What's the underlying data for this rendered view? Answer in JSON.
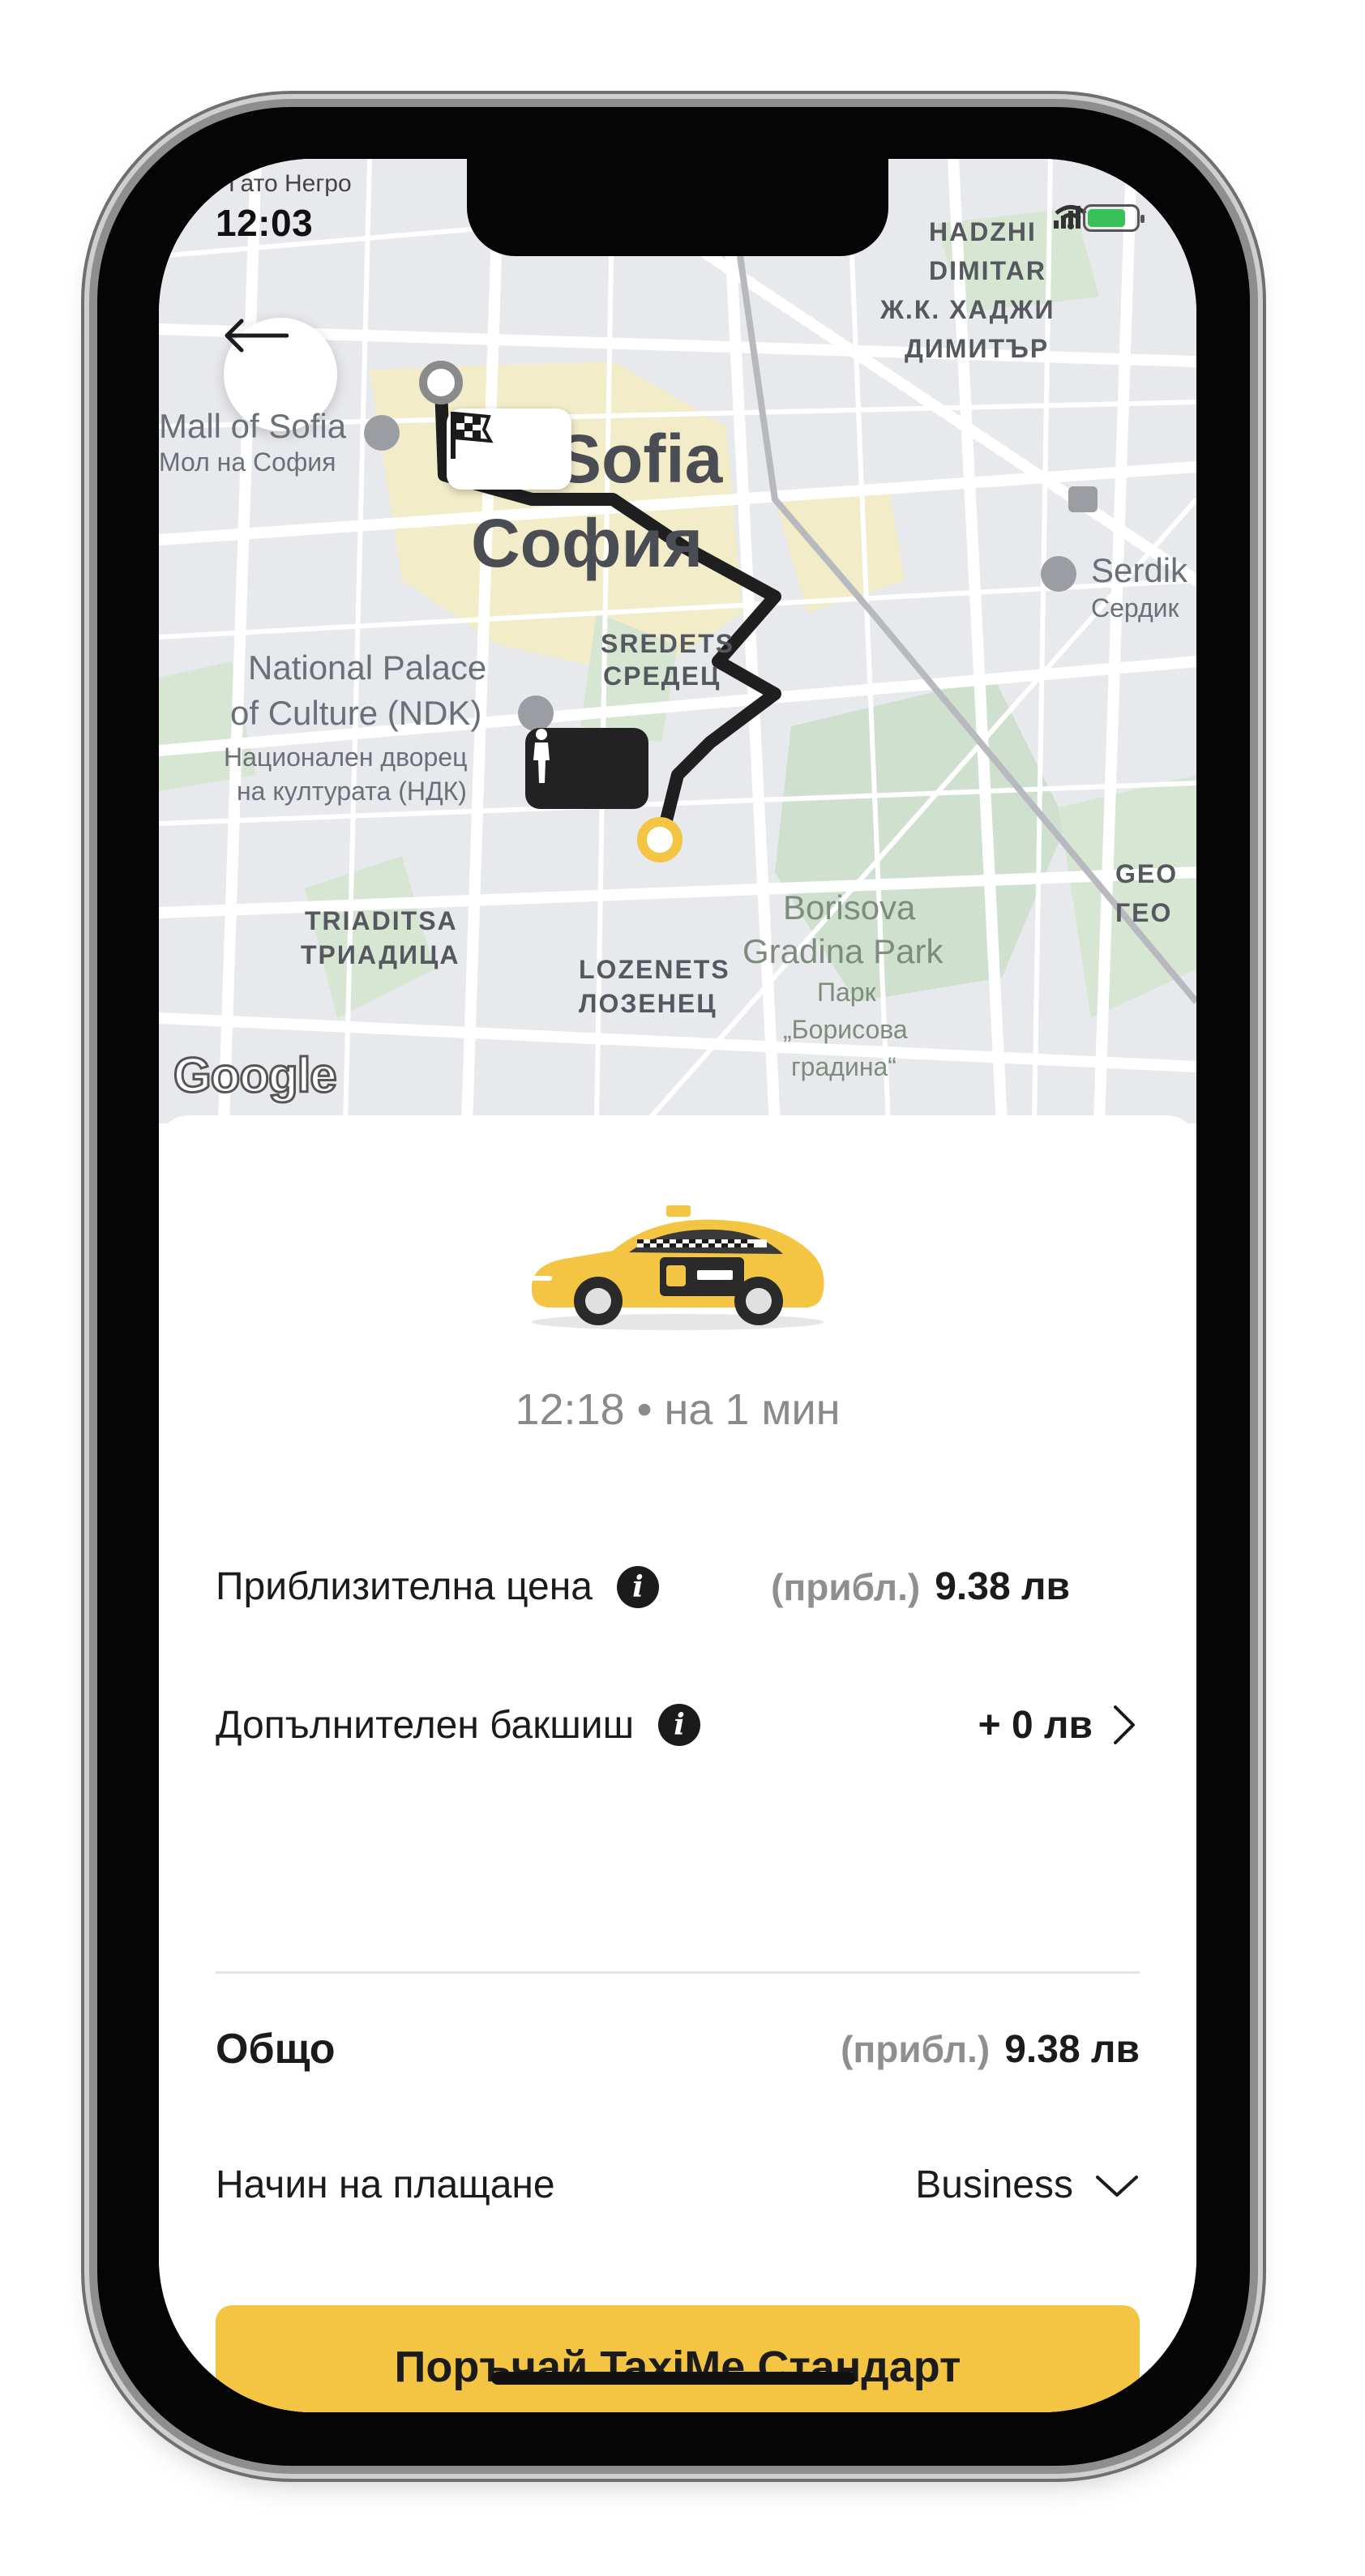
{
  "status_bar": {
    "time": "12:03",
    "back_app": "Гато Негро"
  },
  "map": {
    "labels": {
      "hadzhi_latin": "HADZHI",
      "dimitar_latin": "DIMITAR",
      "hadzhi_cyr": "Ж.К. ХАДЖИ",
      "dimitar_cyr": "ДИМИТЪР",
      "mall_latin": "Mall of Sofia",
      "mall_cyr": "Мол на София",
      "sofia_latin": "Sofia",
      "sofia_cyr": "София",
      "serdika_latin": "Serdik",
      "serdika_cyr": "Сердик",
      "sredets_latin": "SREDETS",
      "sredets_cyr": "СРЕДЕЦ",
      "ndk_1": "National Palace",
      "ndk_2": "of Culture (NDK)",
      "ndk_cyr_1": "Национален дворец",
      "ndk_cyr_2": "на културата (НДК)",
      "triaditsa_latin": "TRIADITSA",
      "triaditsa_cyr": "ТРИАДИЦА",
      "lozenets_latin": "LOZENETS",
      "lozenets_cyr": "ЛОЗЕНЕЦ",
      "park_1": "Borisova",
      "park_2": "Gradina Park",
      "park_cyr_1": "Парк",
      "park_cyr_2": "„Борисова",
      "park_cyr_3": "градина“",
      "geo_latin": "GEO",
      "geo_cyr": "ГЕО"
    },
    "attribution": "Google"
  },
  "ride": {
    "eta": "12:18 • на 1 мин"
  },
  "price": {
    "label": "Приблизителна цена",
    "approx": "(прибл.)",
    "value": "9.38 лв"
  },
  "tip": {
    "label": "Допълнителен бакшиш",
    "value": "+ 0 лв"
  },
  "total": {
    "label": "Общо",
    "approx": "(прибл.)",
    "value": "9.38 лв"
  },
  "payment": {
    "label": "Начин на плащане",
    "value": "Business"
  },
  "order_button": {
    "label": "Поръчай TaxiMe Стандарт"
  },
  "colors": {
    "accent": "#f4c542",
    "route": "#1f1f1f",
    "park": "#cfe3cf",
    "downtown": "#f3e7b8"
  }
}
